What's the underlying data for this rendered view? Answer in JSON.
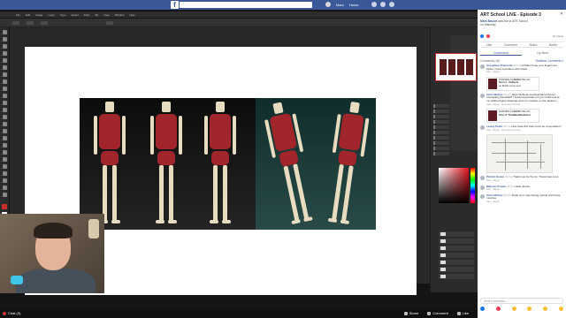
{
  "facebook": {
    "logo": "f",
    "user_name": "Marc",
    "home_label": "Home",
    "colors": {
      "brand": "#3b5998"
    }
  },
  "photoshop": {
    "menu": [
      "File",
      "Edit",
      "Image",
      "Layer",
      "Type",
      "Select",
      "Filter",
      "3D",
      "View",
      "Window",
      "Help"
    ],
    "tools_icon": "toolbar-icons",
    "foreground_color": "#c9302c",
    "background_color": "#ffffff"
  },
  "stream": {
    "live_label": "Live",
    "viewers": "Chat (3)",
    "actions": [
      "Share",
      "Comment",
      "Like"
    ]
  },
  "post": {
    "title": "ART School LIVE - Episode 3",
    "author": "Marc Brunet",
    "meta_suffix": "was live in ART School",
    "date": "on Saturday",
    "views": "1K Views",
    "actions": [
      "Like",
      "Comment",
      "Share",
      "Buffer"
    ],
    "tabs": [
      "Comments",
      "Up Next"
    ],
    "comments_count": "Comments (16)",
    "comments_order": "Realtime Comments ▾"
  },
  "comments": [
    {
      "name": "Josephine Prancotta",
      "time": "21 hrs",
      "text": "Hi Marc! hope your fingers are better, i have a problem with scale!",
      "links": "Like · Reply"
    },
    {
      "name": "Chris Molnyz",
      "time": "21 hrs",
      "text": "https://lmbiotic.com/tutorial-ref-bone-f-Imlmspanyy/anat/ART i would appreciate it if you could look at my clothed figure drawings and my muscles on the skeleton",
      "links": "Like · Reply · Remove Preview"
    },
    {
      "name": "Lesley Parks",
      "time": "21 hrs",
      "text": "How does this look so far as composition?",
      "links": "Like · Reply · Remove Preview"
    },
    {
      "name": "Patrick Hosler",
      "time": "21 hrs",
      "text": "Thank you for the tip. Those help a ton.",
      "links": "Like · Reply"
    },
    {
      "name": "Malcom Ponder",
      "time": "21 hrs",
      "text": "Hello stream",
      "links": "Like · Reply"
    },
    {
      "name": "Chris Molnyz",
      "time": "21 hrs",
      "text": "thank you I was having trouble with those muscles",
      "links": "Like · Reply"
    }
  ],
  "attachments": [
    {
      "title": "Term 3 - Palmest",
      "source": "FORUMS.CUBEBRUSH.CO",
      "desc": "no Marlin cover.com"
    },
    {
      "title": "Term 3: ThatBluePanGhost",
      "source": "FORUMS.CUBEBRUSH.CO",
      "desc": ""
    }
  ],
  "compose_placeholder": "Write a comment...",
  "reactions_label": "Like · Love · Haha · Wow · Sad · Angry"
}
